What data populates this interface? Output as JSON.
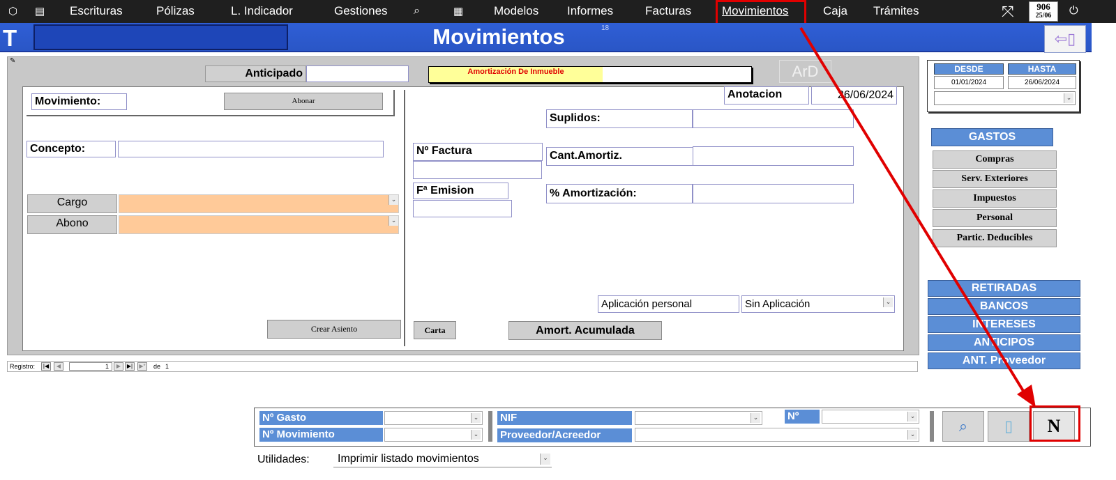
{
  "nav": {
    "items": [
      "Escrituras",
      "Pólizas",
      "L. Indicador",
      "Gestiones",
      "Modelos",
      "Informes",
      "Facturas",
      "Movimientos",
      "Caja",
      "Trámites"
    ],
    "badge_number": "906",
    "badge_date": "25/06"
  },
  "header": {
    "prefix": "T",
    "title": "Movimientos",
    "small_number": "18"
  },
  "form": {
    "anticipado_label": "Anticipado",
    "amortizacion_inmueble": "Amortización De Inmueble",
    "ard_label": "ArD",
    "movimiento_label": "Movimiento:",
    "abonar_button": "Abonar",
    "concepto_label": "Concepto:",
    "cargo_label": "Cargo",
    "abono_label": "Abono",
    "crear_asiento_button": "Crear Asiento",
    "anotacion_label": "Anotacion",
    "anotacion_date": "26/06/2024",
    "suplidos_label": "Suplidos:",
    "factura_label": "Nº Factura",
    "cant_amortiz_label": "Cant.Amortiz.",
    "emision_label": "Fª Emision",
    "pct_amortizacion_label": "% Amortización:",
    "aplicacion_label": "Aplicación personal",
    "aplicacion_value": "Sin Aplicación",
    "carta_button": "Carta",
    "amort_acumulada_button": "Amort. Acumulada"
  },
  "record_nav": {
    "label": "Registro:",
    "current": "1",
    "of_label": "de",
    "total": "1"
  },
  "dates": {
    "desde_label": "DESDE",
    "hasta_label": "HASTA",
    "desde_value": "01/01/2024",
    "hasta_value": "26/06/2024"
  },
  "gastos": {
    "title": "GASTOS",
    "items": [
      "Compras",
      "Serv. Exteriores",
      "Impuestos",
      "Personal",
      "Partic. Deducibles"
    ]
  },
  "side_sections": [
    "RETIRADAS",
    "BANCOS",
    "INTERESES",
    "ANTICIPOS",
    "ANT. Proveedor"
  ],
  "search": {
    "gasto_label": "Nº Gasto",
    "movimiento_label": "Nº Movimiento",
    "nif_label": "NIF",
    "num_label": "Nº",
    "proveedor_label": "Proveedor/Acreedor",
    "new_button": "N"
  },
  "utilidades": {
    "label": "Utilidades:",
    "value": "Imprimir listado movimientos"
  },
  "colors": {
    "accent_blue": "#5b8ed6",
    "title_blue": "#2f5fd6",
    "highlight_red": "#e00000",
    "account_orange": "#ffca99",
    "yellow_field": "#ffff99"
  }
}
